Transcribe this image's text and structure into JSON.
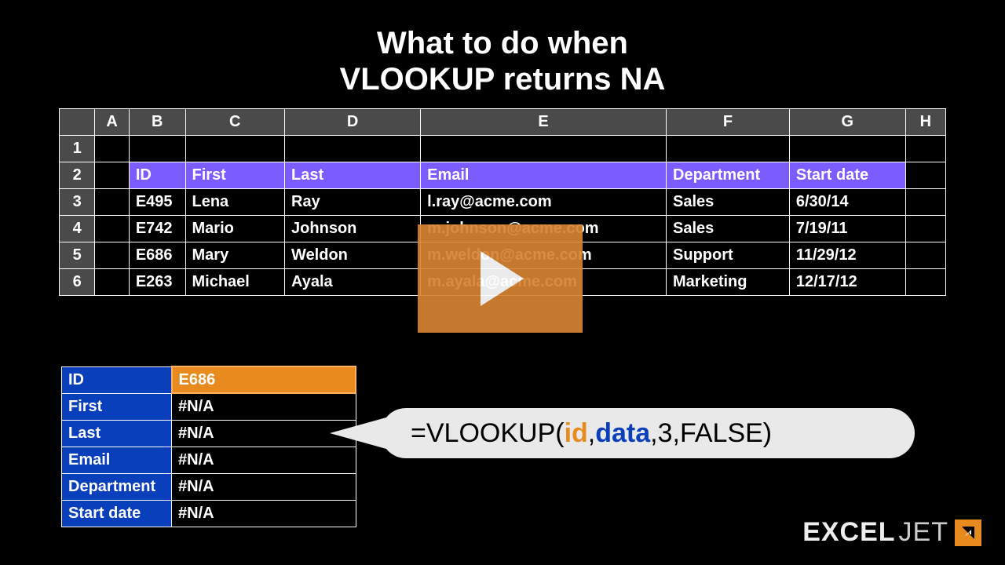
{
  "title_line1": "What to do when",
  "title_line2": "VLOOKUP returns NA",
  "columns": [
    "A",
    "B",
    "C",
    "D",
    "E",
    "F",
    "G",
    "H"
  ],
  "header_row": {
    "b": "ID",
    "c": "First",
    "d": "Last",
    "e": "Email",
    "f": "Department",
    "g": "Start date"
  },
  "rows": [
    {
      "n": "1"
    },
    {
      "n": "2"
    },
    {
      "n": "3",
      "b": "E495",
      "c": "Lena",
      "d": "Ray",
      "e": "l.ray@acme.com",
      "f": "Sales",
      "g": "6/30/14"
    },
    {
      "n": "4",
      "b": "E742",
      "c": "Mario",
      "d": "Johnson",
      "e": "m.johnson@acme.com",
      "f": "Sales",
      "g": "7/19/11"
    },
    {
      "n": "5",
      "b": "E686",
      "c": "Mary",
      "d": "Weldon",
      "e": "m.weldon@acme.com",
      "f": "Support",
      "g": "11/29/12"
    },
    {
      "n": "6",
      "b": "E263",
      "c": "Michael",
      "d": "Ayala",
      "e": "m.ayala@acme.com",
      "f": "Marketing",
      "g": "12/17/12"
    }
  ],
  "lookup": {
    "id_label": "ID",
    "id_value": "E686",
    "first_label": "First",
    "first_value": "#N/A",
    "last_label": "Last",
    "last_value": "#N/A",
    "email_label": "Email",
    "email_value": "#N/A",
    "dept_label": "Department",
    "dept_value": "#N/A",
    "start_label": "Start date",
    "start_value": "#N/A"
  },
  "formula": {
    "prefix": "=VLOOKUP(",
    "id": "id",
    "c1": ",",
    "data": "data",
    "suffix": ",3,FALSE)"
  },
  "logo": {
    "part1": "EXCEL",
    "part2": "JET"
  }
}
